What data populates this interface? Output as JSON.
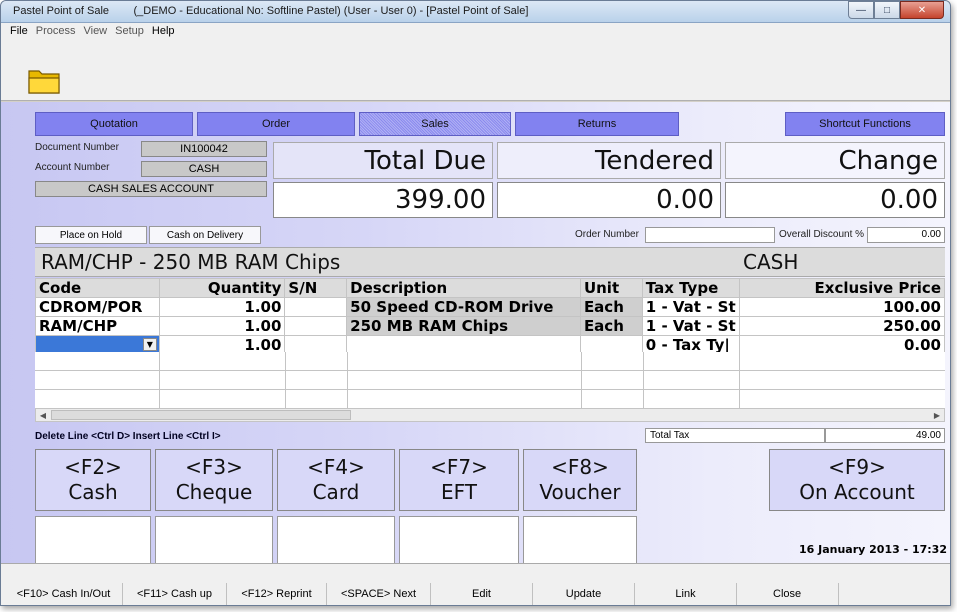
{
  "window": {
    "app_name": "Pastel Point of Sale",
    "title_detail": "(_DEMO - Educational No: Softline Pastel) (User - User 0) - [Pastel Point of Sale]"
  },
  "menu": [
    "File",
    "Process",
    "View",
    "Setup",
    "Help"
  ],
  "modes": {
    "quotation": "Quotation",
    "order": "Order",
    "sales": "Sales",
    "returns": "Returns",
    "shortcut": "Shortcut Functions"
  },
  "document": {
    "doc_number_label": "Document Number",
    "doc_number": "IN100042",
    "account_number_label": "Account Number",
    "account_number": "CASH",
    "account_name": "CASH SALES ACCOUNT"
  },
  "totals": {
    "total_due_label": "Total Due",
    "total_due": "399.00",
    "tendered_label": "Tendered",
    "tendered": "0.00",
    "change_label": "Change",
    "change": "0.00"
  },
  "options": {
    "place_on_hold": "Place on Hold",
    "cash_on_delivery": "Cash on Delivery",
    "order_number_label": "Order Number",
    "order_number": "",
    "overall_discount_label": "Overall Discount %",
    "overall_discount": "0.00"
  },
  "current_item": {
    "description": "RAM/CHP - 250 MB RAM Chips",
    "account": "CASH"
  },
  "grid": {
    "headers": {
      "code": "Code",
      "quantity": "Quantity",
      "sn": "S/N",
      "description": "Description",
      "unit": "Unit",
      "tax_type": "Tax Type",
      "price": "Exclusive Price"
    },
    "rows": [
      {
        "code": "CDROM/POR",
        "quantity": "1.00",
        "sn": "",
        "description": "50 Speed CD-ROM Drive",
        "unit": "Each",
        "tax_type": "1 - Vat - St",
        "price": "100.00"
      },
      {
        "code": "RAM/CHP",
        "quantity": "1.00",
        "sn": "",
        "description": "250 MB RAM Chips",
        "unit": "Each",
        "tax_type": "1 - Vat - St",
        "price": "250.00"
      },
      {
        "code": "",
        "quantity": "1.00",
        "sn": "",
        "description": "",
        "unit": "",
        "tax_type": "0 - Tax Ty|",
        "price": "0.00"
      }
    ]
  },
  "footer": {
    "hint": "Delete Line <Ctrl D>  Insert Line <Ctrl I>",
    "total_tax_label": "Total Tax",
    "total_tax": "49.00",
    "date": "16 January 2013 - 17:32"
  },
  "payment_keys": [
    {
      "key": "<F2>",
      "label": "Cash"
    },
    {
      "key": "<F3>",
      "label": "Cheque"
    },
    {
      "key": "<F4>",
      "label": "Card"
    },
    {
      "key": "<F7>",
      "label": "EFT"
    },
    {
      "key": "<F8>",
      "label": "Voucher"
    },
    {
      "key": "<F9>",
      "label": "On Account"
    }
  ],
  "bottom_buttons": {
    "cash_in_out": "<F10> Cash In/Out",
    "cash_up": "<F11> Cash up",
    "reprint": "<F12> Reprint",
    "next": "<SPACE> Next",
    "edit": "Edit",
    "update": "Update",
    "link": "Link",
    "close": "Close"
  }
}
